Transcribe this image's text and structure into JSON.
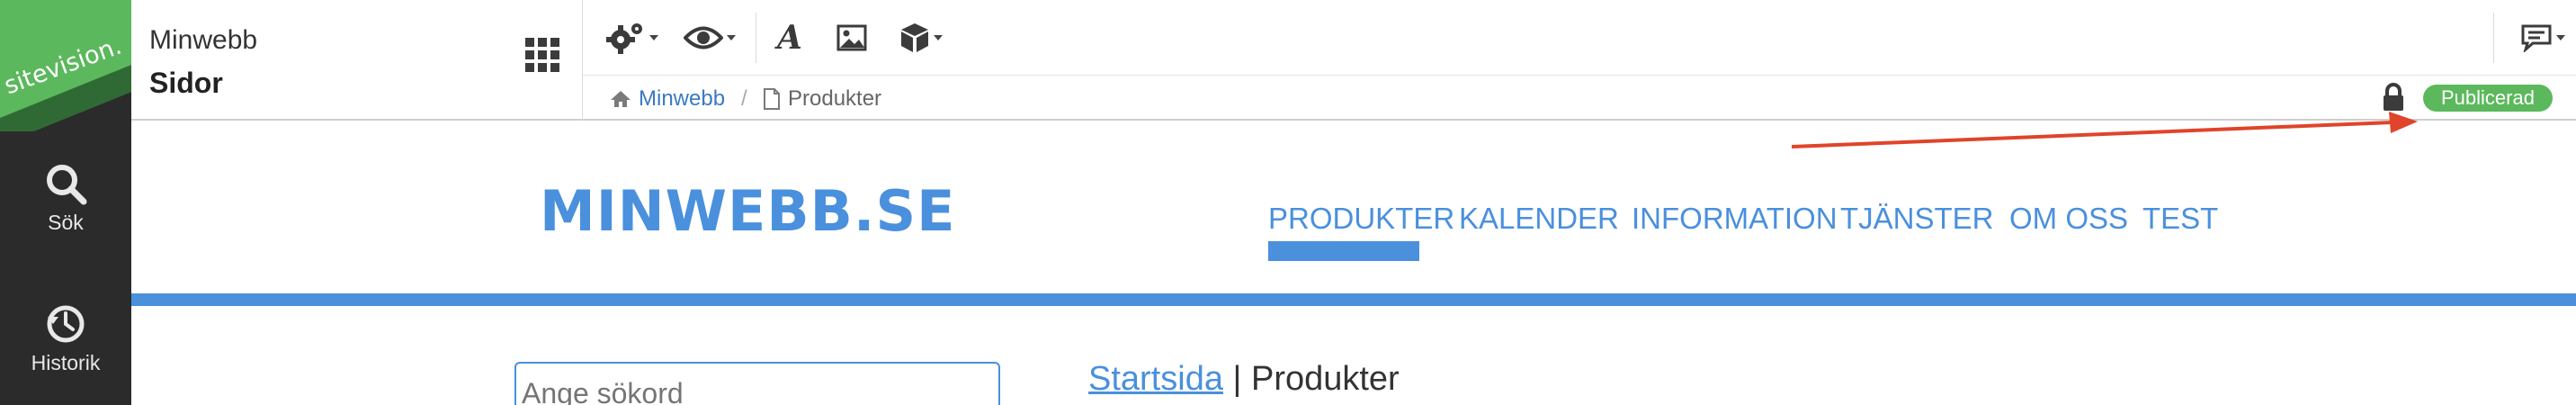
{
  "sidebar": {
    "logo_text": "sitevision.",
    "items": [
      {
        "label": "Sök",
        "icon": "search-icon"
      },
      {
        "label": "Historik",
        "icon": "history-icon"
      }
    ]
  },
  "header": {
    "site_name": "Minwebb",
    "page_type": "Sidor"
  },
  "toolbar": {
    "tools": [
      "settings-icon",
      "preview-eye-icon",
      "font-icon",
      "image-icon",
      "module-box-icon"
    ],
    "right_tool": "feedback-icon"
  },
  "breadcrumb": {
    "home": "Minwebb",
    "separator": "/",
    "page": "Produkter"
  },
  "status": {
    "badge": "Publicerad",
    "badge_color": "#5cb85c"
  },
  "preview": {
    "logo": "MINWEBB.SE",
    "nav": [
      "PRODUKTER",
      "KALENDER",
      "INFORMATION",
      "TJÄNSTER",
      "OM OSS",
      "TEST"
    ],
    "active_nav": "PRODUKTER",
    "search_placeholder": "Ange sökord",
    "page_crumb_link": "Startsida",
    "page_crumb_sep": " | ",
    "page_crumb_current": "Produkter",
    "accent_color": "#4a90dd"
  },
  "annotation": {
    "arrow_color": "#e0442a"
  }
}
